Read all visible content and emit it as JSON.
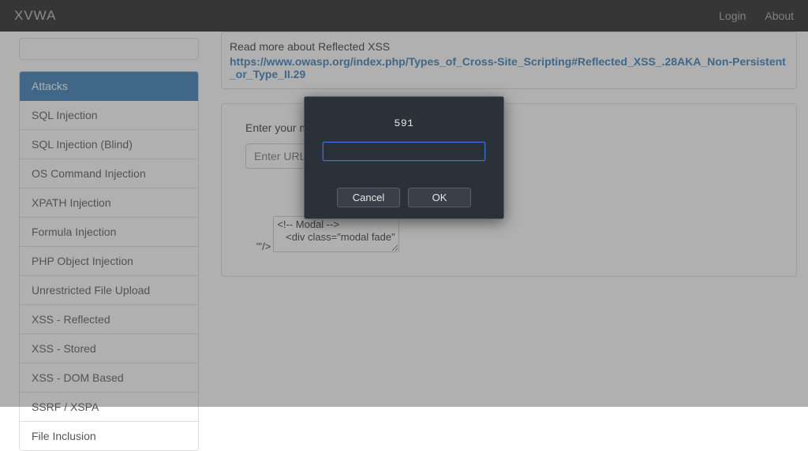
{
  "navbar": {
    "brand": "XVWA",
    "links": {
      "login": "Login",
      "about": "About"
    }
  },
  "sidebar": {
    "header": "Attacks",
    "items": [
      "SQL Injection",
      "SQL Injection (Blind)",
      "OS Command Injection",
      "XPATH Injection",
      "Formula Injection",
      "PHP Object Injection",
      "Unrestricted File Upload",
      "XSS - Reflected",
      "XSS - Stored",
      "XSS - DOM Based",
      "SSRF / XSPA",
      "File Inclusion"
    ]
  },
  "info_panel": {
    "lead": "Read more about Reflected XSS",
    "link_text": "https://www.owasp.org/index.php/Types_of_Cross-Site_Scripting#Reflected_XSS_.28AKA_Non-Persistent_or_Type_II.29"
  },
  "form": {
    "label": "Enter your mess",
    "url_placeholder": "Enter URL of",
    "ta_prefix": "\"'/>",
    "ta_value": "<!-- Modal -->\n   <div class=\"modal fade\""
  },
  "prompt": {
    "message": "591",
    "cancel": "Cancel",
    "ok": "OK",
    "input_value": ""
  }
}
